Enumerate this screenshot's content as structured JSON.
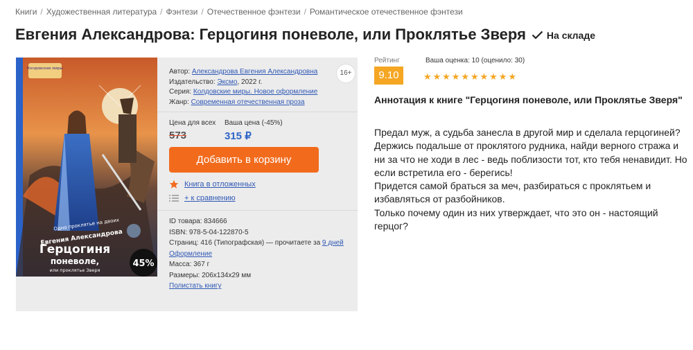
{
  "breadcrumbs": [
    "Книги",
    "Художественная литература",
    "Фэнтези",
    "Отечественное фэнтези",
    "Романтическое отечественное фэнтези"
  ],
  "title": "Евгения Александрова: Герцогиня поневоле, или Проклятье Зверя",
  "stock": {
    "label": "На складе",
    "icon": "check-icon"
  },
  "book": {
    "age": "16+",
    "cover": {
      "series_badge": "Колдовские миры",
      "tagline": "Одно проклятье на двоих",
      "author": "Евгения Александрова",
      "title_line1": "Герцогиня",
      "title_line2": "поневоле,",
      "subtitle": "или проклятье Зверя",
      "discount": "45%"
    },
    "author_label": "Автор:",
    "author": "Александрова Евгения Александровна",
    "publisher_label": "Издательство:",
    "publisher": "Эксмо",
    "year": ", 2022 г.",
    "series_label": "Серия:",
    "series": "Колдовские миры. Новое оформление",
    "genre_label": "Жанр:",
    "genre": "Современная отечественная проза"
  },
  "price": {
    "all_label": "Цена для всех",
    "old": "573",
    "yours_label": "Ваша цена (-45%)",
    "new": "315 ₽"
  },
  "actions": {
    "cart": "Добавить в корзину",
    "favorite": "Книга в отложенных",
    "compare": "+ к сравнению"
  },
  "details": {
    "id": "ID товара: 834666",
    "isbn": "ISBN: 978-5-04-122870-5",
    "pages_text": "Страниц: 416 (Типографская) — прочитаете за ",
    "pages_link": "9 дней",
    "design": "Оформление",
    "weight": "Масса: 367 г",
    "size": "Размеры: 206x134x29 мм",
    "share": "Полистать книгу"
  },
  "rating": {
    "label": "Рейтинг",
    "value": "9.10",
    "yours": "Ваша оценка: 10 (оценило: 30)",
    "stars": 10,
    "color": "#f5a623"
  },
  "annotation": {
    "title": "Аннотация к книге \"Герцогиня поневоле, или Проклятье Зверя\"",
    "p1": "Предал муж, а судьба занесла в другой мир и сделала герцогиней? Держись подальше от проклятого рудника, найди верного стража и ни за что не ходи в лес - ведь поблизости тот, кто тебя ненавидит. Но если встретила его - берегись!",
    "p2": "Придется самой браться за меч, разбираться с проклятьем и избавляться от разбойников.",
    "p3": "Только почему один из них утверждает, что это он - настоящий герцог?"
  },
  "colors": {
    "accent": "#f26b1d",
    "link": "#2f58b5",
    "price": "#2f64c8",
    "rating": "#f5a623"
  }
}
